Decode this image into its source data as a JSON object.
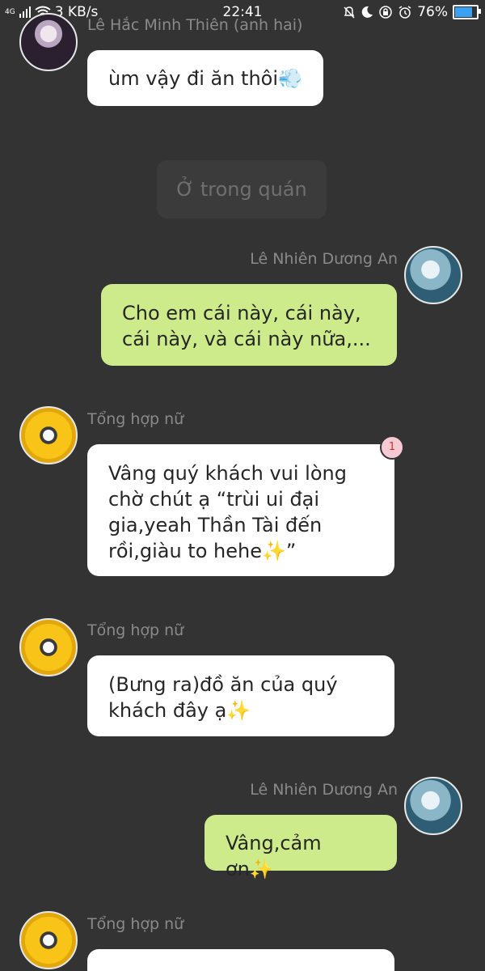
{
  "status_bar": {
    "network_type": "4G",
    "speed": "3 KB/s",
    "time": "22:41",
    "battery": "76%",
    "battery_level": 0.76,
    "icons": [
      "signal-icon",
      "wifi-icon",
      "mute-bell-icon",
      "moon-icon",
      "rotation-lock-icon",
      "alarm-icon",
      "battery-icon"
    ]
  },
  "messages": [
    {
      "type": "incoming",
      "sender": "Lê Hắc Minh Thiên (anh hai)",
      "text": "ùm vậy đi ăn thôi💨",
      "avatar": "avatar-dark-haired-girl"
    },
    {
      "type": "system",
      "text": "Ở trong quán"
    },
    {
      "type": "outgoing",
      "sender": "Lê Nhiên Dương An",
      "text": "Cho em cái này, cái này, cái này, và cái này nữa,...",
      "avatar": "avatar-blue-haired-boy"
    },
    {
      "type": "incoming",
      "sender": "Tổng hợp nữ",
      "text": "Vâng quý khách vui lòng chờ chút ạ “trùi ui đại gia,yeah Thần Tài đến rồi,giàu to hehe✨”",
      "badge": "1",
      "avatar": "avatar-sunflower-dog"
    },
    {
      "type": "incoming",
      "sender": "Tổng hợp nữ",
      "text": "(Bưng ra)đồ ăn của quý khách đây ạ✨",
      "avatar": "avatar-sunflower-dog"
    },
    {
      "type": "outgoing",
      "sender": "Lê Nhiên Dương An",
      "text": "Vâng,cảm ơn✨",
      "avatar": "avatar-blue-haired-boy"
    },
    {
      "type": "incoming",
      "sender": "Tổng hợp nữ",
      "text": "",
      "avatar": "avatar-sunflower-dog"
    }
  ]
}
